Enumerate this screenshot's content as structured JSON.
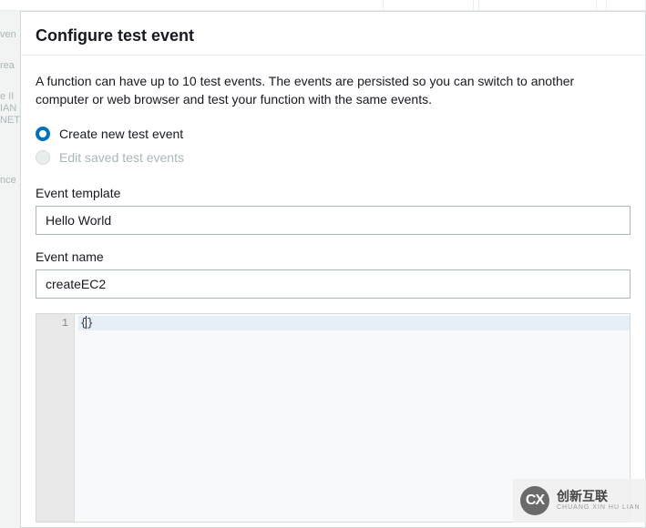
{
  "modal": {
    "title": "Configure test event",
    "description": "A function can have up to 10 test events. The events are persisted so you can switch to another computer or web browser and test your function with the same events.",
    "radios": {
      "create_label": "Create new test event",
      "edit_label": "Edit saved test events"
    },
    "event_template": {
      "label": "Event template",
      "value": "Hello World"
    },
    "event_name": {
      "label": "Event name",
      "value": "createEC2"
    },
    "code": {
      "line1_text": "{}",
      "line1_number": "1"
    }
  },
  "watermark": {
    "logo_text": "CX",
    "cn": "创新互联",
    "en": "CHUANG XIN HU LIAN"
  },
  "bg": {
    "frag1": "ven",
    "frag2": "rea",
    "frag3": "e II",
    "frag4": "IAN",
    "frag5": "NET",
    "frag6": "nce"
  }
}
